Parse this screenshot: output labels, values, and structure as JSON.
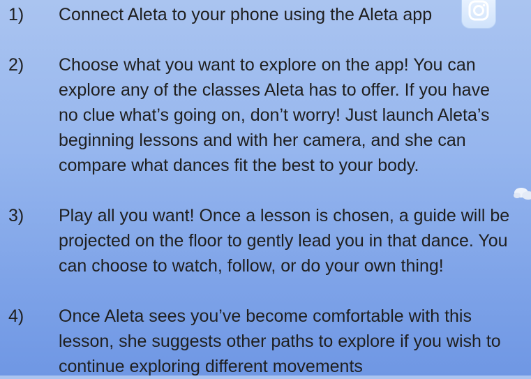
{
  "steps": [
    {
      "number": "1)",
      "text": "Connect Aleta to your phone using the Aleta app"
    },
    {
      "number": "2)",
      "text": "Choose what you want to explore on the app! You can\nexplore any of the classes Aleta has to offer. If you have\nno clue what’s going on, don’t worry! Just launch Aleta’s\nbeginning lessons and with her camera, and she can\ncompare what dances fit the best to your body."
    },
    {
      "number": "3)",
      "text": "Play all you want! Once a lesson is chosen, a guide will be\nprojected on the floor to gently lead you in that dance. You\ncan choose to watch, follow, or do your own thing!"
    },
    {
      "number": "4)",
      "text": "Once Aleta sees you’ve become comfortable with this\nlesson, she suggests other paths to explore if you wish to\ncontinue exploring different movements"
    }
  ],
  "icons": {
    "app_icon": "camera-app-icon",
    "decoration": "hand-decoration-icon"
  },
  "colors": {
    "background_top": "#aac4f0",
    "background_bottom": "#6f97e4",
    "text": "#1f1f1f"
  }
}
